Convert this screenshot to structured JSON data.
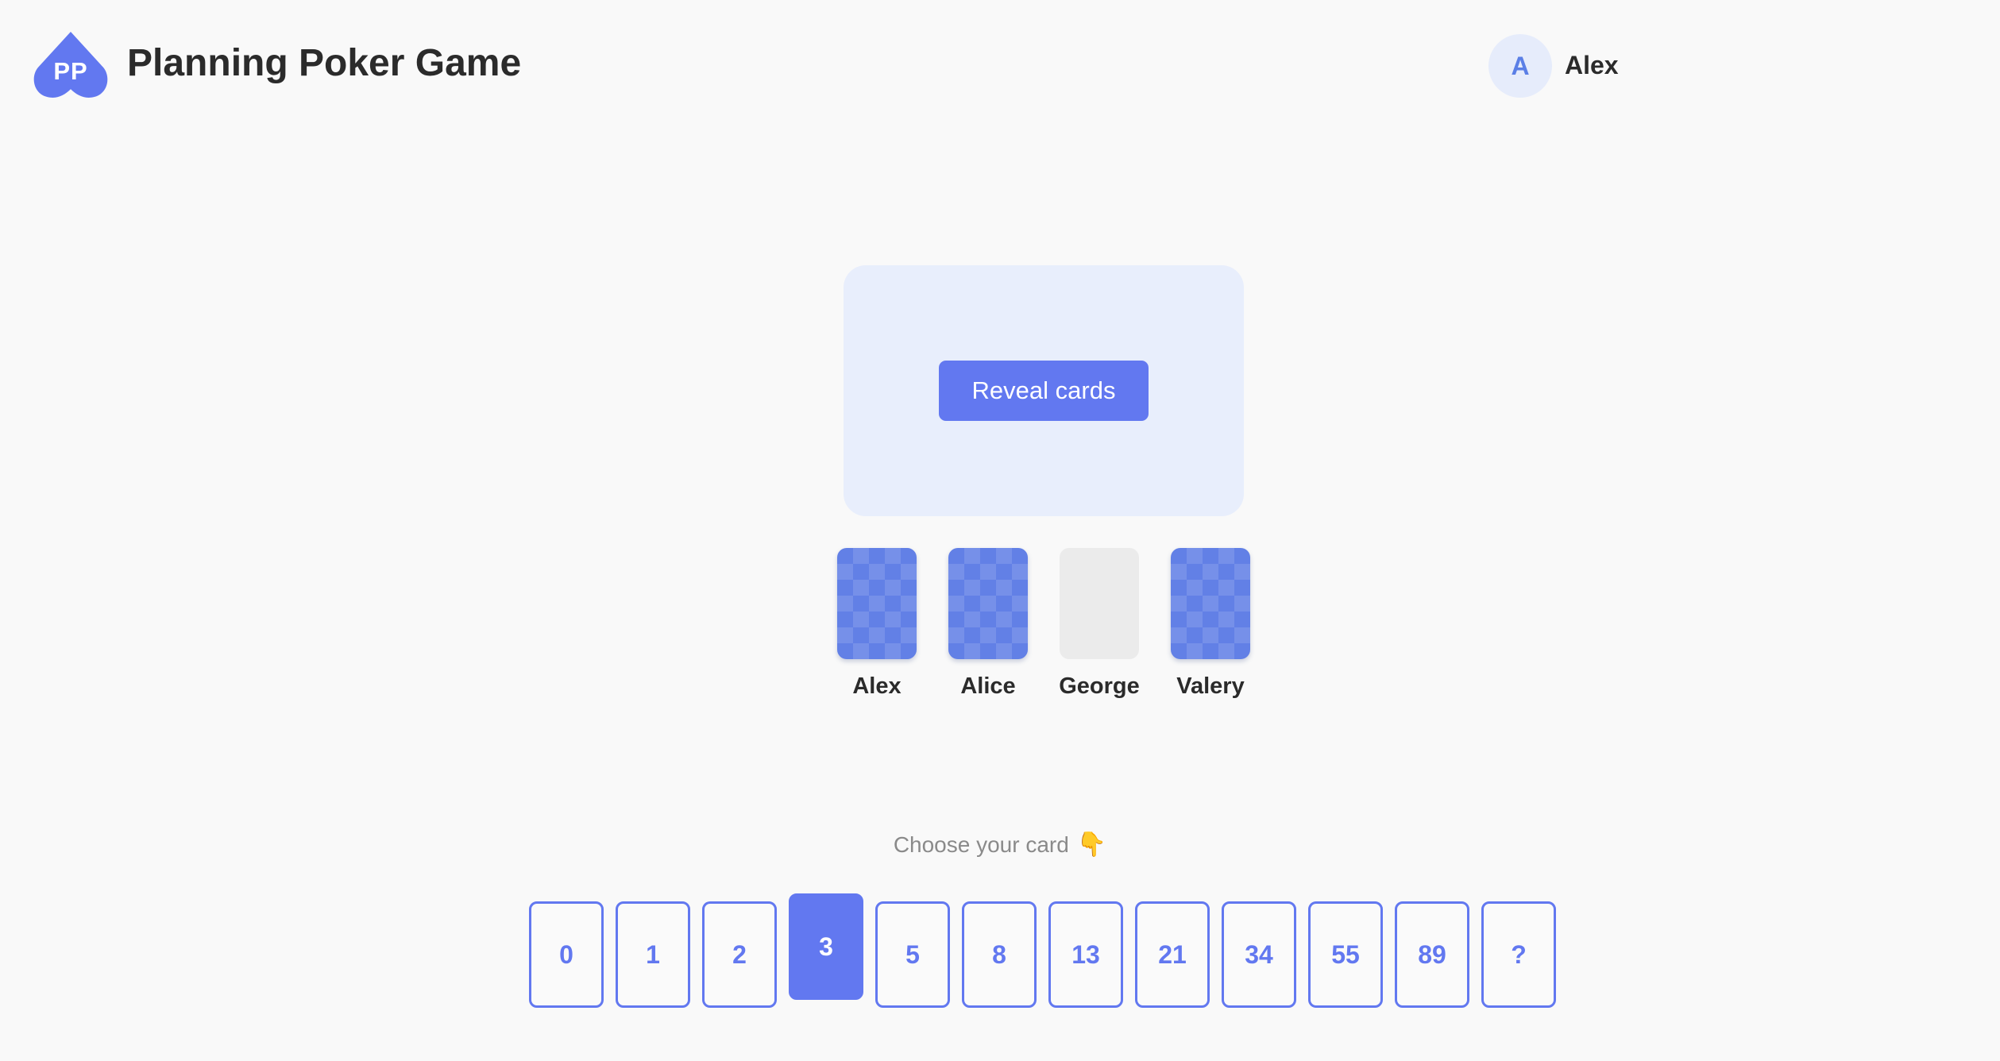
{
  "header": {
    "logo_text": "PP",
    "title": "Planning Poker Game",
    "user": {
      "initial": "A",
      "name": "Alex"
    }
  },
  "table": {
    "reveal_button_label": "Reveal cards"
  },
  "players": [
    {
      "name": "Alex",
      "status": "voted"
    },
    {
      "name": "Alice",
      "status": "voted"
    },
    {
      "name": "George",
      "status": "empty"
    },
    {
      "name": "Valery",
      "status": "voted"
    }
  ],
  "deck": {
    "prompt": "Choose your card",
    "prompt_icon": "👇",
    "cards": [
      "0",
      "1",
      "2",
      "3",
      "5",
      "8",
      "13",
      "21",
      "34",
      "55",
      "89",
      "?"
    ],
    "selected": "3"
  },
  "colors": {
    "accent": "#6278f0",
    "card_back": "#6280e6",
    "table_bg": "#e8eefc",
    "avatar_bg": "#e6ecfb"
  }
}
